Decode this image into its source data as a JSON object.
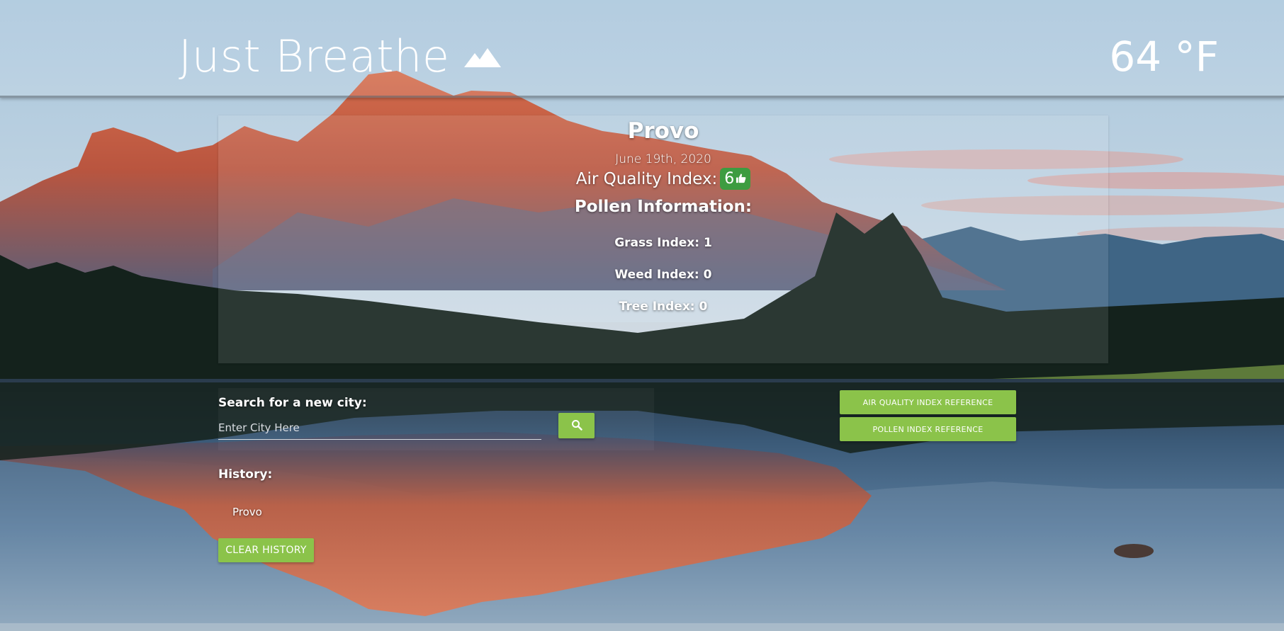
{
  "header": {
    "title": "Just Breathe",
    "icon": "mountain-icon",
    "temperature": "64 °F"
  },
  "card": {
    "city": "Provo",
    "date": "June 19th, 2020",
    "aqi_label": "Air Quality Index:",
    "aqi_value": "6",
    "aqi_icon": "thumbs-up-icon",
    "aqi_color": "#3d9c40",
    "pollen_title": "Pollen Information:",
    "pollen": [
      {
        "label": "Grass Index: 1"
      },
      {
        "label": "Weed Index: 0"
      },
      {
        "label": "Tree Index: 0"
      }
    ]
  },
  "search": {
    "label": "Search for a new city:",
    "placeholder": "Enter City Here",
    "button_icon": "search-icon"
  },
  "history": {
    "label": "History:",
    "items": [
      "Provo"
    ],
    "clear_label": "CLEAR HISTORY"
  },
  "references": {
    "aqi_label": "AIR QUALITY INDEX REFERENCE",
    "pollen_label": "POLLEN INDEX REFERENCE"
  },
  "theme": {
    "accent": "#8bc34a"
  }
}
